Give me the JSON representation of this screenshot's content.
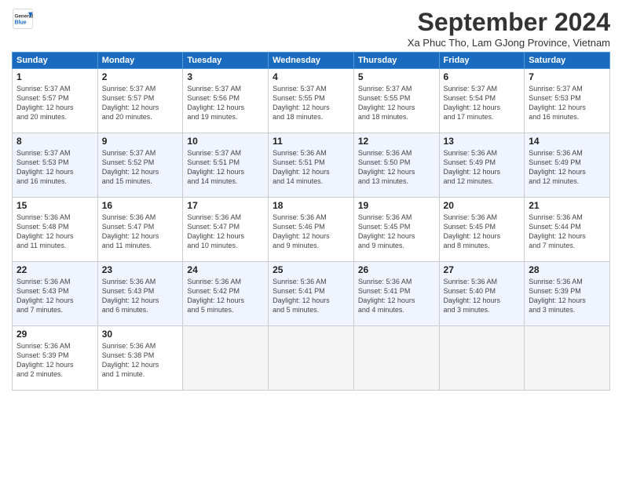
{
  "header": {
    "logo_general": "General",
    "logo_blue": "Blue",
    "month_title": "September 2024",
    "subtitle": "Xa Phuc Tho, Lam GJong Province, Vietnam"
  },
  "weekdays": [
    "Sunday",
    "Monday",
    "Tuesday",
    "Wednesday",
    "Thursday",
    "Friday",
    "Saturday"
  ],
  "weeks": [
    [
      {
        "day": "1",
        "info": "Sunrise: 5:37 AM\nSunset: 5:57 PM\nDaylight: 12 hours\nand 20 minutes."
      },
      {
        "day": "2",
        "info": "Sunrise: 5:37 AM\nSunset: 5:57 PM\nDaylight: 12 hours\nand 20 minutes."
      },
      {
        "day": "3",
        "info": "Sunrise: 5:37 AM\nSunset: 5:56 PM\nDaylight: 12 hours\nand 19 minutes."
      },
      {
        "day": "4",
        "info": "Sunrise: 5:37 AM\nSunset: 5:55 PM\nDaylight: 12 hours\nand 18 minutes."
      },
      {
        "day": "5",
        "info": "Sunrise: 5:37 AM\nSunset: 5:55 PM\nDaylight: 12 hours\nand 18 minutes."
      },
      {
        "day": "6",
        "info": "Sunrise: 5:37 AM\nSunset: 5:54 PM\nDaylight: 12 hours\nand 17 minutes."
      },
      {
        "day": "7",
        "info": "Sunrise: 5:37 AM\nSunset: 5:53 PM\nDaylight: 12 hours\nand 16 minutes."
      }
    ],
    [
      {
        "day": "8",
        "info": "Sunrise: 5:37 AM\nSunset: 5:53 PM\nDaylight: 12 hours\nand 16 minutes."
      },
      {
        "day": "9",
        "info": "Sunrise: 5:37 AM\nSunset: 5:52 PM\nDaylight: 12 hours\nand 15 minutes."
      },
      {
        "day": "10",
        "info": "Sunrise: 5:37 AM\nSunset: 5:51 PM\nDaylight: 12 hours\nand 14 minutes."
      },
      {
        "day": "11",
        "info": "Sunrise: 5:36 AM\nSunset: 5:51 PM\nDaylight: 12 hours\nand 14 minutes."
      },
      {
        "day": "12",
        "info": "Sunrise: 5:36 AM\nSunset: 5:50 PM\nDaylight: 12 hours\nand 13 minutes."
      },
      {
        "day": "13",
        "info": "Sunrise: 5:36 AM\nSunset: 5:49 PM\nDaylight: 12 hours\nand 12 minutes."
      },
      {
        "day": "14",
        "info": "Sunrise: 5:36 AM\nSunset: 5:49 PM\nDaylight: 12 hours\nand 12 minutes."
      }
    ],
    [
      {
        "day": "15",
        "info": "Sunrise: 5:36 AM\nSunset: 5:48 PM\nDaylight: 12 hours\nand 11 minutes."
      },
      {
        "day": "16",
        "info": "Sunrise: 5:36 AM\nSunset: 5:47 PM\nDaylight: 12 hours\nand 11 minutes."
      },
      {
        "day": "17",
        "info": "Sunrise: 5:36 AM\nSunset: 5:47 PM\nDaylight: 12 hours\nand 10 minutes."
      },
      {
        "day": "18",
        "info": "Sunrise: 5:36 AM\nSunset: 5:46 PM\nDaylight: 12 hours\nand 9 minutes."
      },
      {
        "day": "19",
        "info": "Sunrise: 5:36 AM\nSunset: 5:45 PM\nDaylight: 12 hours\nand 9 minutes."
      },
      {
        "day": "20",
        "info": "Sunrise: 5:36 AM\nSunset: 5:45 PM\nDaylight: 12 hours\nand 8 minutes."
      },
      {
        "day": "21",
        "info": "Sunrise: 5:36 AM\nSunset: 5:44 PM\nDaylight: 12 hours\nand 7 minutes."
      }
    ],
    [
      {
        "day": "22",
        "info": "Sunrise: 5:36 AM\nSunset: 5:43 PM\nDaylight: 12 hours\nand 7 minutes."
      },
      {
        "day": "23",
        "info": "Sunrise: 5:36 AM\nSunset: 5:43 PM\nDaylight: 12 hours\nand 6 minutes."
      },
      {
        "day": "24",
        "info": "Sunrise: 5:36 AM\nSunset: 5:42 PM\nDaylight: 12 hours\nand 5 minutes."
      },
      {
        "day": "25",
        "info": "Sunrise: 5:36 AM\nSunset: 5:41 PM\nDaylight: 12 hours\nand 5 minutes."
      },
      {
        "day": "26",
        "info": "Sunrise: 5:36 AM\nSunset: 5:41 PM\nDaylight: 12 hours\nand 4 minutes."
      },
      {
        "day": "27",
        "info": "Sunrise: 5:36 AM\nSunset: 5:40 PM\nDaylight: 12 hours\nand 3 minutes."
      },
      {
        "day": "28",
        "info": "Sunrise: 5:36 AM\nSunset: 5:39 PM\nDaylight: 12 hours\nand 3 minutes."
      }
    ],
    [
      {
        "day": "29",
        "info": "Sunrise: 5:36 AM\nSunset: 5:39 PM\nDaylight: 12 hours\nand 2 minutes."
      },
      {
        "day": "30",
        "info": "Sunrise: 5:36 AM\nSunset: 5:38 PM\nDaylight: 12 hours\nand 1 minute."
      },
      {
        "day": "",
        "info": ""
      },
      {
        "day": "",
        "info": ""
      },
      {
        "day": "",
        "info": ""
      },
      {
        "day": "",
        "info": ""
      },
      {
        "day": "",
        "info": ""
      }
    ]
  ]
}
